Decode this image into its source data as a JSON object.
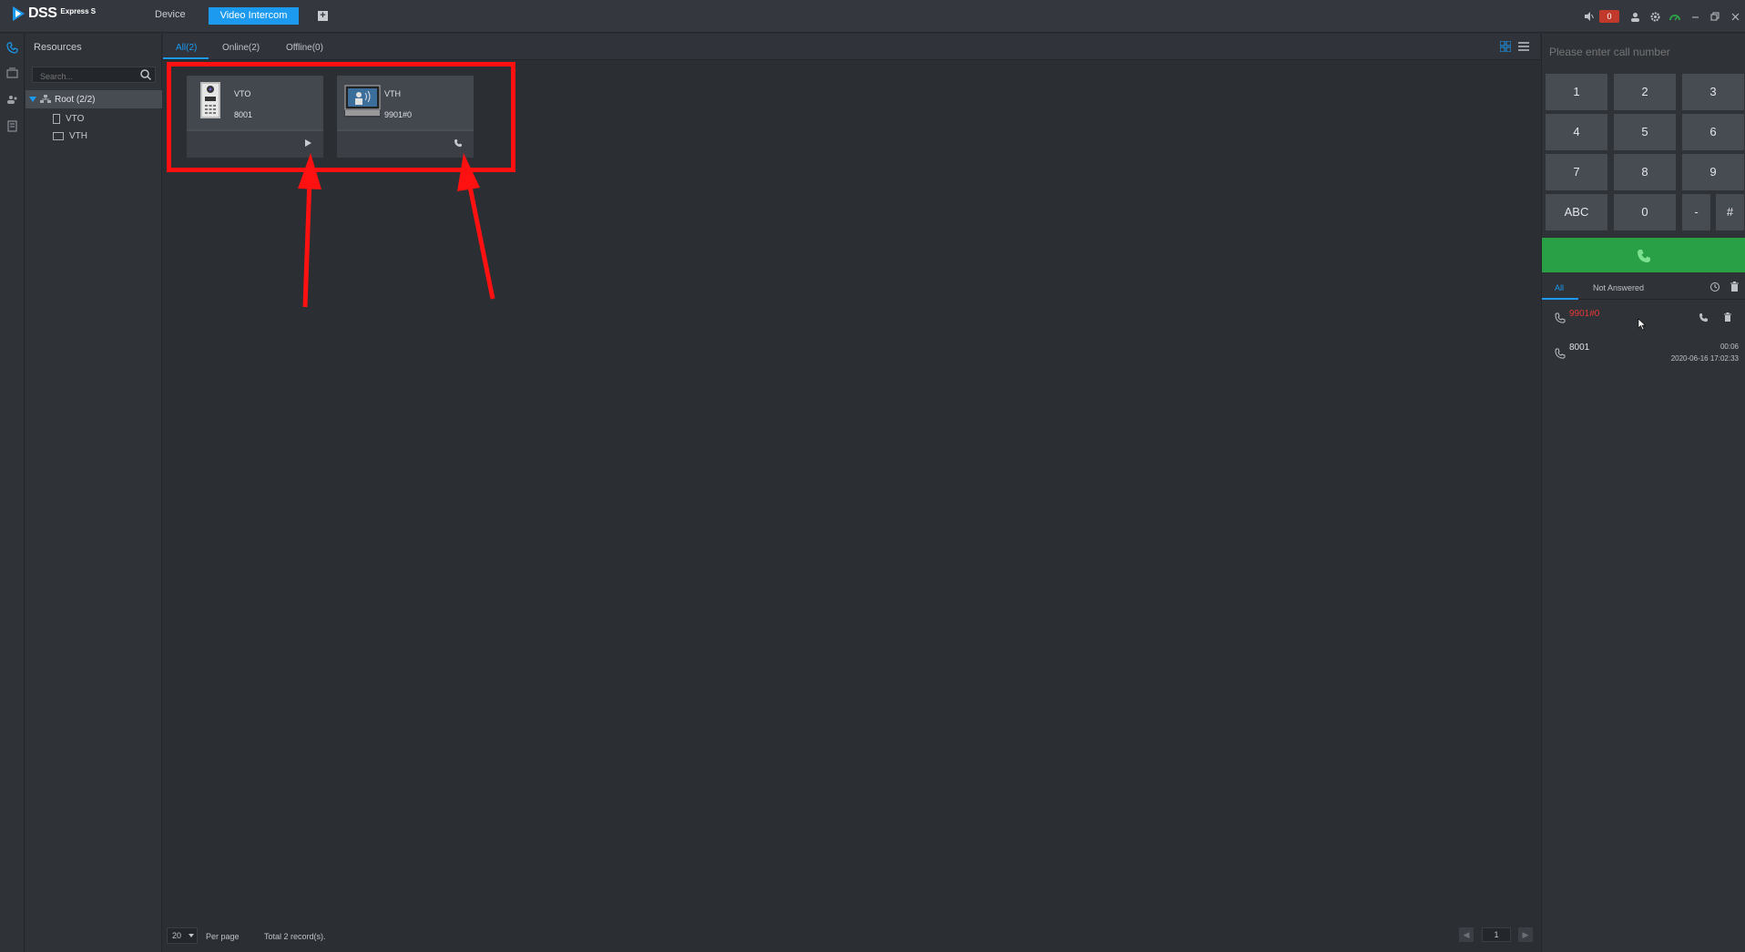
{
  "app": {
    "logo": "DSS",
    "logo_sub": "Express S"
  },
  "nav": {
    "device": "Device",
    "video_intercom": "Video Intercom"
  },
  "topbar": {
    "alarm_count": "0"
  },
  "resources": {
    "title": "Resources",
    "search_placeholder": "Search...",
    "root": "Root (2/2)",
    "items": [
      {
        "label": "VTO"
      },
      {
        "label": "VTH"
      }
    ]
  },
  "tabs": [
    {
      "label": "All(2)"
    },
    {
      "label": "Online(2)"
    },
    {
      "label": "Offline(0)"
    }
  ],
  "devices": [
    {
      "name": "VTO",
      "number": "8001",
      "action": "play"
    },
    {
      "name": "VTH",
      "number": "9901#0",
      "action": "call"
    }
  ],
  "pagination": {
    "per_page_value": "20",
    "per_page_label": "Per page",
    "total": "Total 2 record(s).",
    "current_page": "1"
  },
  "dialpad": {
    "placeholder": "Please enter call number",
    "keys": [
      "1",
      "2",
      "3",
      "4",
      "5",
      "6",
      "7",
      "8",
      "9",
      "ABC",
      "0",
      "-",
      "#"
    ]
  },
  "records_tabs": [
    {
      "label": "All"
    },
    {
      "label": "Not Answered"
    }
  ],
  "records": [
    {
      "number": "9901#0",
      "status": "missed",
      "duration": "",
      "datetime": ""
    },
    {
      "number": "8001",
      "status": "normal",
      "duration": "00:06",
      "datetime": "2020-06-16 17:02:33"
    }
  ],
  "colors": {
    "accent": "#1b9af0",
    "call_green": "#2aa046",
    "annotation_red": "#ff1111",
    "missed_red": "#e53935"
  }
}
